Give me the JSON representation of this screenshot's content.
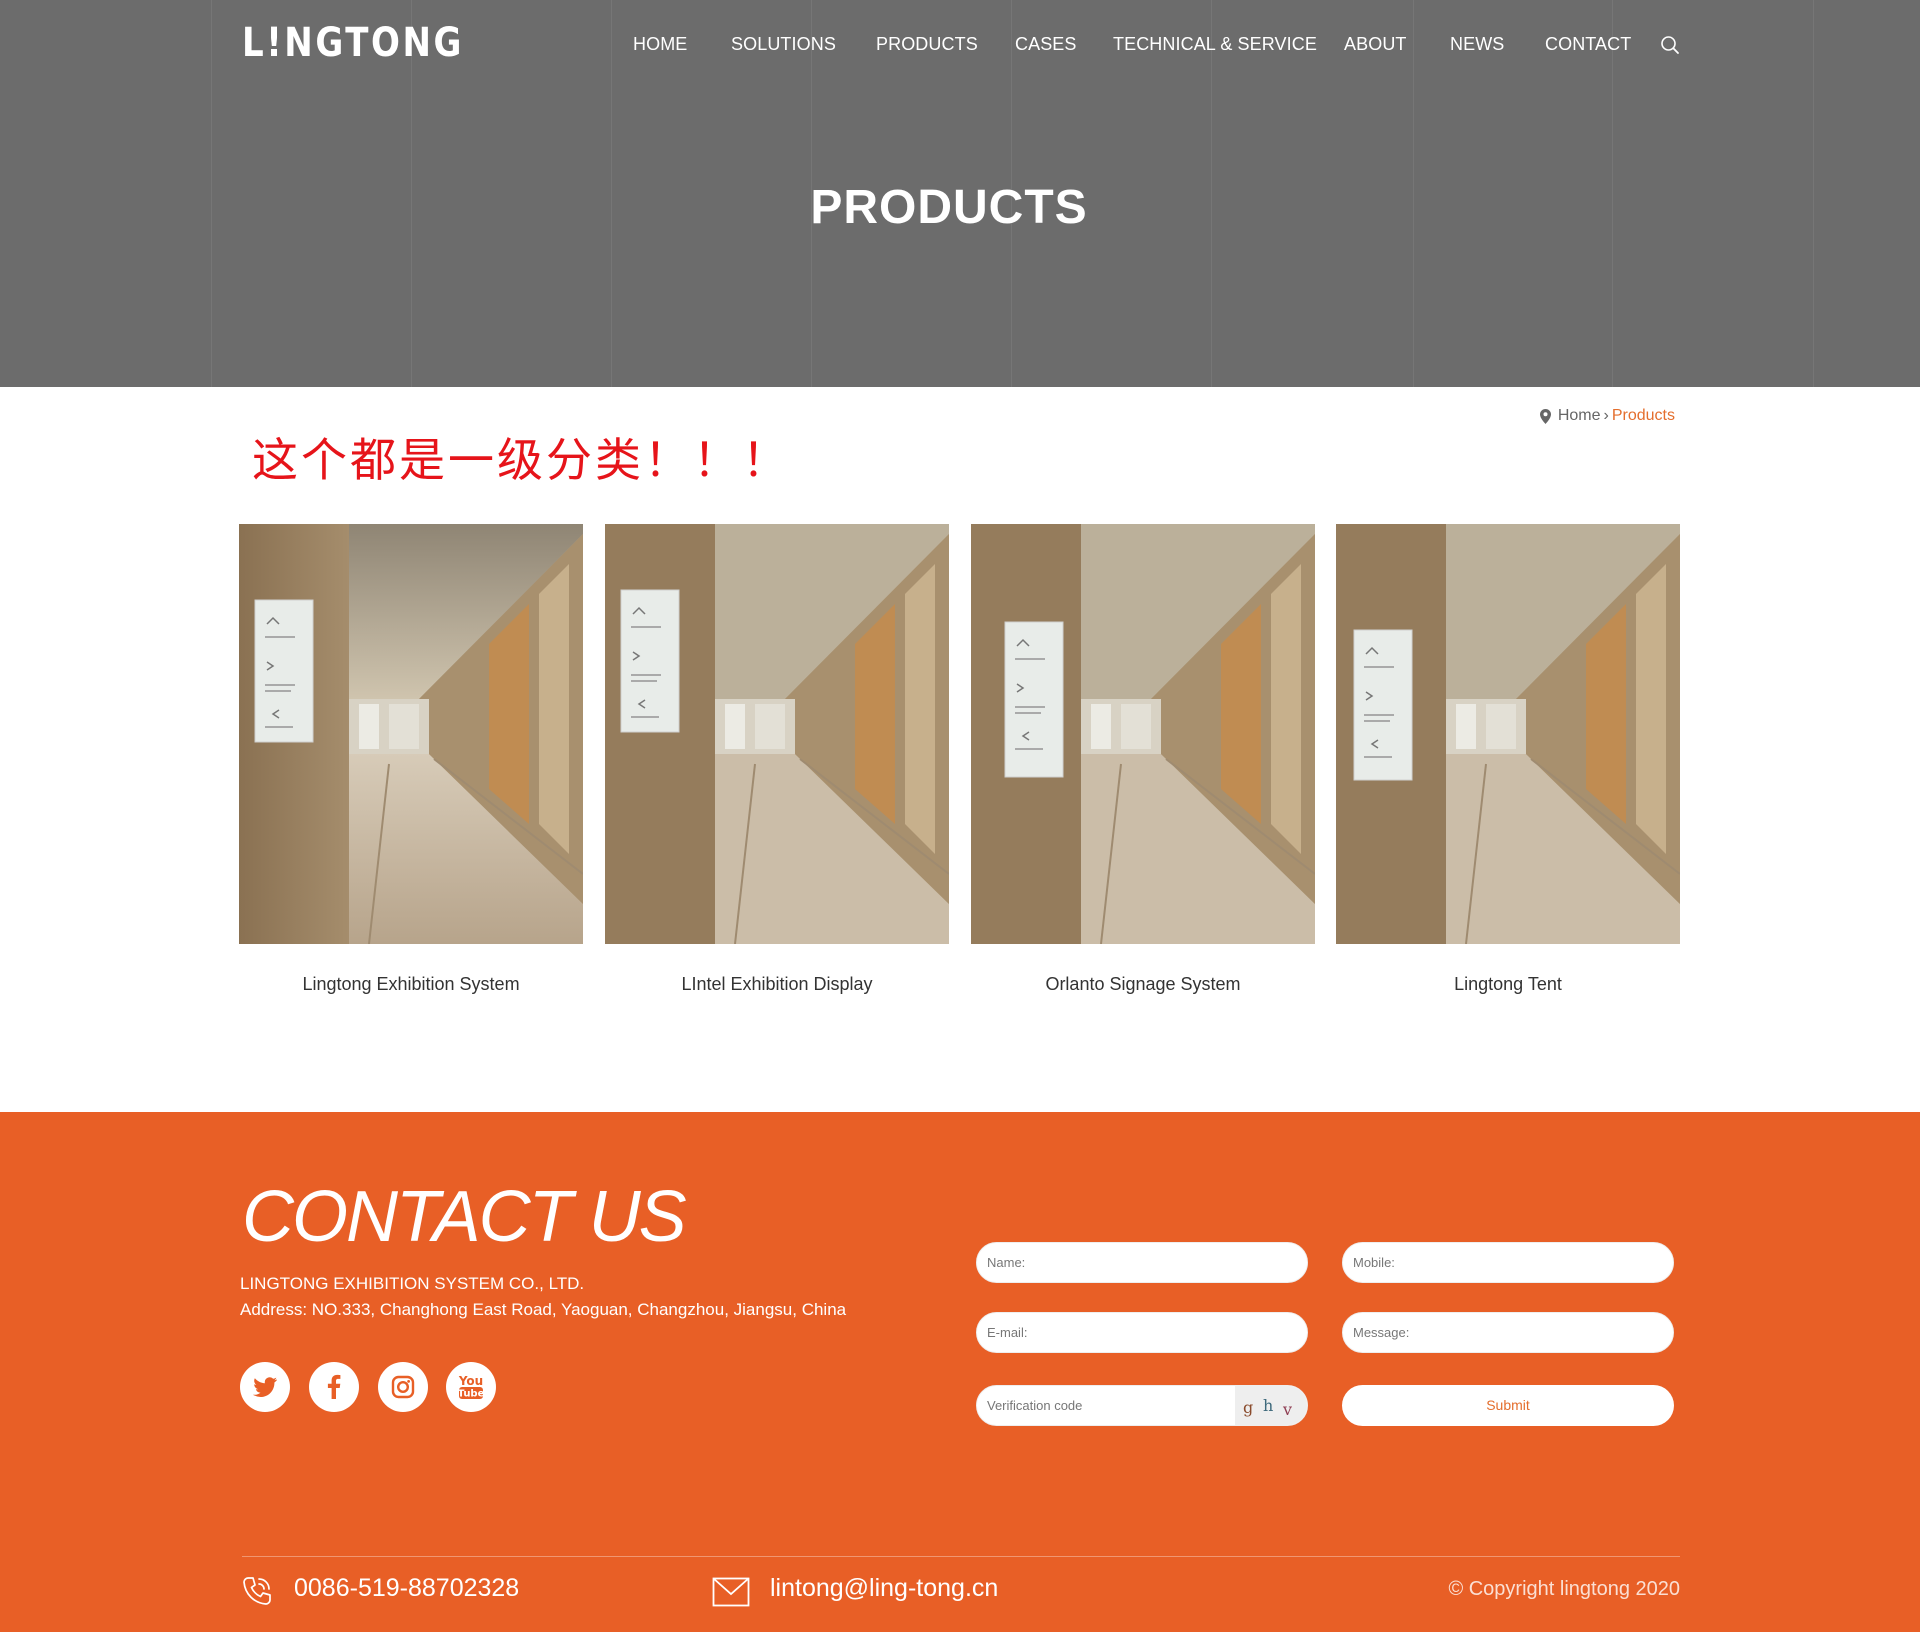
{
  "header": {
    "logo_text": "L!NGTONG",
    "nav": [
      "HOME",
      "SOLUTIONS",
      "PRODUCTS",
      "CASES",
      "TECHNICAL & SERVICE",
      "ABOUT",
      "NEWS",
      "CONTACT"
    ]
  },
  "hero": {
    "title": "PRODUCTS"
  },
  "breadcrumb": {
    "home": "Home",
    "separator": "›",
    "current": "Products"
  },
  "annotation": "这个都是一级分类！！！",
  "products": [
    {
      "name": "Lingtong Exhibition System"
    },
    {
      "name": "LIntel Exhibition Display"
    },
    {
      "name": "Orlanto Signage System"
    },
    {
      "name": "Lingtong Tent"
    }
  ],
  "contact": {
    "title": "CONTACT US",
    "company": "LINGTONG EXHIBITION SYSTEM CO., LTD.",
    "address": "Address: NO.333, Changhong East Road, Yaoguan, Changzhou, Jiangsu, China",
    "social": [
      "twitter-icon",
      "facebook-icon",
      "instagram-icon",
      "youtube-icon"
    ],
    "form": {
      "name_placeholder": "Name:",
      "mobile_placeholder": "Mobile:",
      "email_placeholder": "E-mail:",
      "message_placeholder": "Message:",
      "verification_placeholder": "Verification code",
      "captcha_chars": [
        "g",
        "h",
        "v"
      ],
      "submit_label": "Submit"
    }
  },
  "footer": {
    "phone": "0086-519-88702328",
    "email": "lintong@ling-tong.cn",
    "copyright": "© Copyright lingtong 2020"
  },
  "colors": {
    "hero_bg": "#6c6c6c",
    "accent_orange": "#e85f26",
    "link_orange": "#e46e2d",
    "annotation_red": "#e6141a"
  }
}
